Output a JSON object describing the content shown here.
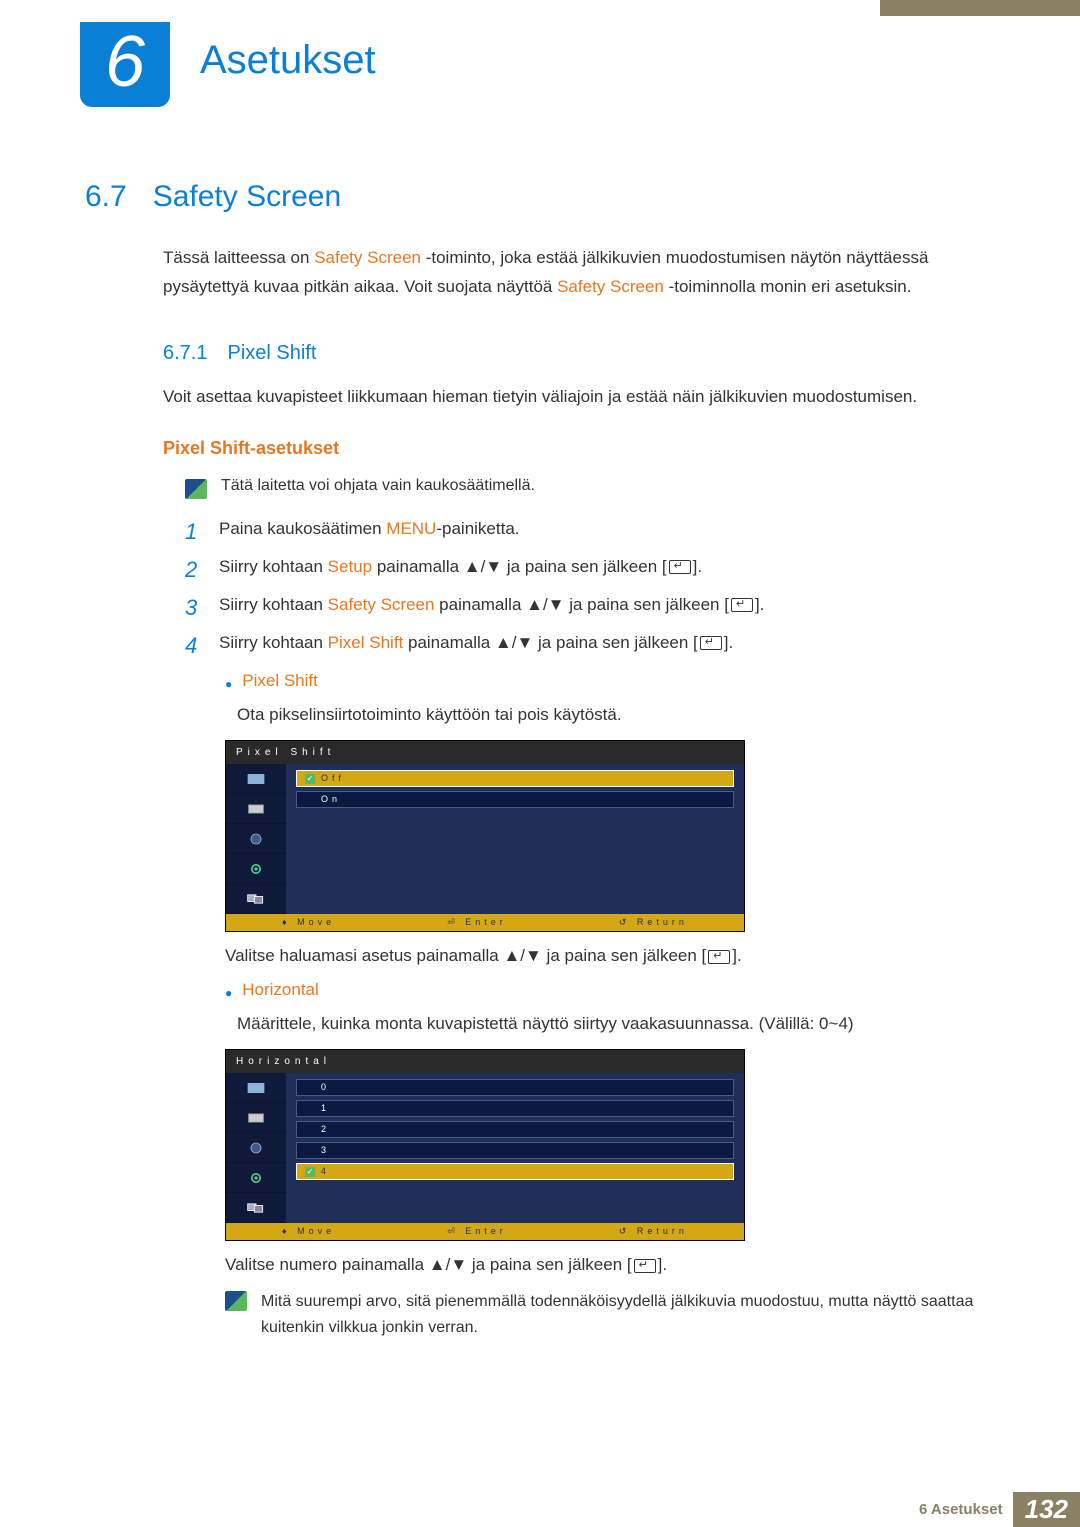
{
  "chapter": {
    "number": "6",
    "title": "Asetukset"
  },
  "safety_screen_term": "Safety Screen",
  "section": {
    "num": "6.7",
    "title": "Safety Screen",
    "intro_a": "Tässä laitteessa on ",
    "intro_b": " -toiminto, joka estää jälkikuvien muodostumisen näytön näyttäessä pysäytettyä kuvaa pitkän aikaa. Voit suojata näyttöä ",
    "intro_c": " -toiminnolla monin eri asetuksin."
  },
  "sub": {
    "num": "6.7.1",
    "title": "Pixel Shift",
    "desc": "Voit asettaa kuvapisteet liikkumaan hieman tietyin väliajoin ja estää näin jälkikuvien muodostumisen."
  },
  "orange_head": "Pixel Shift-asetukset",
  "note1": "Tätä laitetta voi ohjata vain kaukosäätimellä.",
  "steps": {
    "s1_a": "Paina kaukosäätimen ",
    "s1_hl": "MENU",
    "s1_b": "-painiketta.",
    "s2_a": "Siirry kohtaan ",
    "s2_hl": "Setup",
    "s2_b": " painamalla ▲/▼ ja paina sen jälkeen [",
    "s2_c": "].",
    "s3_a": "Siirry kohtaan ",
    "s3_hl": "Safety Screen",
    "s3_b": " painamalla ▲/▼ ja paina sen jälkeen [",
    "s3_c": "].",
    "s4_a": "Siirry kohtaan ",
    "s4_hl": "Pixel Shift",
    "s4_b": " painamalla ▲/▼ ja paina sen jälkeen [",
    "s4_c": "]."
  },
  "bullet_ps": {
    "label": "Pixel Shift",
    "text": "Ota pikselinsiirtotoiminto käyttöön tai pois käytöstä."
  },
  "osd1": {
    "title": "Pixel Shift",
    "opts": [
      "Off",
      "On"
    ],
    "foot": {
      "move": "Move",
      "enter": "Enter",
      "return": "Return"
    }
  },
  "post_osd1_a": "Valitse haluamasi asetus painamalla ▲/▼ ja paina sen jälkeen [",
  "post_osd1_b": "].",
  "bullet_hz": {
    "label": "Horizontal",
    "text": "Määrittele, kuinka monta kuvapistettä näyttö siirtyy vaakasuunnassa. (Välillä: 0~4)"
  },
  "osd2": {
    "title": "Horizontal",
    "opts": [
      "0",
      "1",
      "2",
      "3",
      "4"
    ],
    "foot": {
      "move": "Move",
      "enter": "Enter",
      "return": "Return"
    }
  },
  "post_osd2_a": "Valitse numero painamalla ▲/▼ ja paina sen jälkeen [",
  "post_osd2_b": "].",
  "note2": "Mitä suurempi arvo, sitä pienemmällä todennäköisyydellä jälkikuvia muodostuu, mutta näyttö saattaa kuitenkin vilkkua jonkin verran.",
  "footer": {
    "label": "6 Asetukset",
    "page": "132"
  }
}
